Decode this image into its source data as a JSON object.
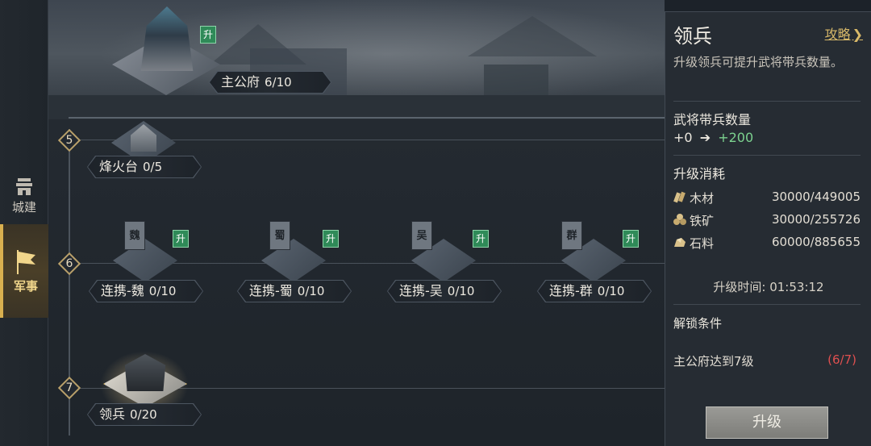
{
  "nav": {
    "items": [
      {
        "label": "城建",
        "icon": "city-wall-icon"
      },
      {
        "label": "军事",
        "icon": "war-flag-icon"
      }
    ]
  },
  "tiers": [
    "5",
    "6",
    "7"
  ],
  "top_building": {
    "name": "主公府",
    "level": "6/10",
    "badge": "升"
  },
  "nodes": {
    "beacon": {
      "name": "烽火台",
      "level": "0/5"
    },
    "wei": {
      "name": "连携-魏",
      "level": "0/10",
      "badge": "升",
      "flag": "魏"
    },
    "shu": {
      "name": "连携-蜀",
      "level": "0/10",
      "badge": "升",
      "flag": "蜀"
    },
    "wu": {
      "name": "连携-吴",
      "level": "0/10",
      "badge": "升",
      "flag": "吴"
    },
    "qun": {
      "name": "连携-群",
      "level": "0/10",
      "badge": "升",
      "flag": "群"
    },
    "command": {
      "name": "领兵",
      "level": "0/20"
    }
  },
  "panel": {
    "title": "领兵",
    "guide_link": "攻略",
    "description": "升级领兵可提升武将带兵数量。",
    "stat_title": "武将带兵数量",
    "stat_from": "+0",
    "stat_arrow": "➔",
    "stat_to": "+200",
    "cost_title": "升级消耗",
    "resources": [
      {
        "name": "木材",
        "value": "30000/449005",
        "icon": "wood-icon"
      },
      {
        "name": "铁矿",
        "value": "30000/255726",
        "icon": "iron-ore-icon"
      },
      {
        "name": "石料",
        "value": "60000/885655",
        "icon": "stone-icon"
      }
    ],
    "upgrade_time": "升级时间: 01:53:12",
    "unlock_title": "解锁条件",
    "unlock_condition": "主公府达到7级",
    "unlock_progress": "(6/7)",
    "upgrade_button": "升级"
  },
  "colors": {
    "accent_gold": "#d8b969",
    "stat_green": "#7cd28f",
    "progress_red": "#e05050",
    "badge_green": "#2f8a58"
  }
}
